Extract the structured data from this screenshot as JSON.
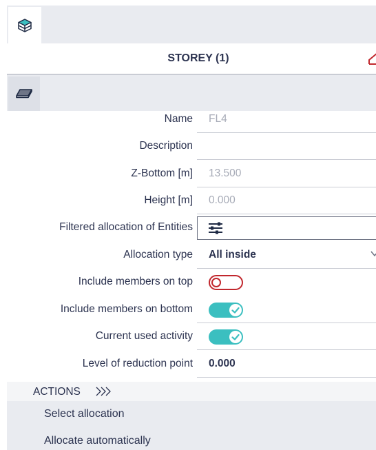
{
  "header": {
    "tab_icon": "storey-3d-icon",
    "title": "STOREY (1)",
    "sub_icon": "storey-plane-icon"
  },
  "properties": [
    {
      "label": "Name",
      "value": "FL4"
    },
    {
      "label": "Description",
      "value": ""
    },
    {
      "label": "Z-Bottom [m]",
      "value": "13.500"
    },
    {
      "label": "Height [m]",
      "value": "0.000"
    },
    {
      "label": "Filtered allocation of Entities",
      "icon": "filter-sliders-icon"
    },
    {
      "label": "Allocation type",
      "value": "All inside"
    },
    {
      "label": "Include members on top",
      "toggle": false
    },
    {
      "label": "Include members on bottom",
      "toggle": true
    },
    {
      "label": "Current used activity",
      "toggle": true
    },
    {
      "label": "Level of reduction point",
      "value": "0.000"
    }
  ],
  "actions": {
    "title": "ACTIONS",
    "items": [
      "Select allocation",
      "Allocate automatically"
    ]
  },
  "colors": {
    "accent": "#3bbfc0",
    "toggle_off": "#c1272d",
    "text": "#2c3350",
    "muted": "#a7abb7"
  }
}
